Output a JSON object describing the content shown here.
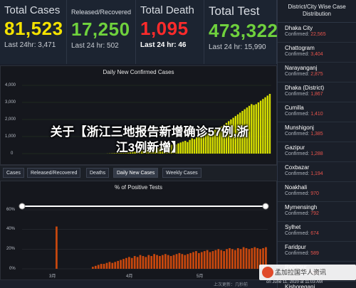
{
  "stats": [
    {
      "title": "Total Cases",
      "value": "81,523",
      "sub_label": "Last 24hr: ",
      "sub_value": "3,471",
      "color": "#f4e200"
    },
    {
      "title": "Released/Recovered",
      "value": "17,250",
      "sub_label": "Last 24 hr: ",
      "sub_value": "502",
      "color": "#6fd13d"
    },
    {
      "title": "Total Death",
      "value": "1,095",
      "sub_label": "Last 24 hr: ",
      "sub_value": "46",
      "color": "#ff2b2b"
    },
    {
      "title": "Total Test",
      "value": "473,322",
      "sub_label": "Last 24 hr: ",
      "sub_value": "15,990",
      "color": "#6fd13d"
    }
  ],
  "chart1": {
    "title": "Daily New Confirmed Cases",
    "yticks": [
      "4,000",
      "3,000",
      "2,000",
      "1,000",
      "0"
    ]
  },
  "chart2": {
    "title": "% of Positive Tests",
    "yticks": [
      "60%",
      "40%",
      "20%",
      "0%"
    ],
    "xlabels": [
      "3月",
      "4月",
      "5月",
      "6月"
    ]
  },
  "tabs": [
    "Cases",
    "Released/Recovered",
    "Deaths",
    "Daily New Cases",
    "Weekly Cases"
  ],
  "sidebar": {
    "title": "District/City Wise Case Distribution",
    "confirmed_label": "Confirmed: ",
    "items": [
      {
        "name": "Dhaka City",
        "value": "22,565"
      },
      {
        "name": "Chattogram",
        "value": "3,404"
      },
      {
        "name": "Narayanganj",
        "value": "2,875"
      },
      {
        "name": "Dhaka (District)",
        "value": "1,867"
      },
      {
        "name": "Cumilla",
        "value": "1,410"
      },
      {
        "name": "Munshigonj",
        "value": "1,385"
      },
      {
        "name": "Gazipur",
        "value": "1,288"
      },
      {
        "name": "Coxbazar",
        "value": "1,194"
      },
      {
        "name": "Noakhali",
        "value": "970"
      },
      {
        "name": "Mymensingh",
        "value": "792"
      },
      {
        "name": "Sylhet",
        "value": "674"
      },
      {
        "name": "Faridpur",
        "value": "589"
      },
      {
        "name": "Rangpur",
        "value": "589"
      },
      {
        "name": "Kishoreganj",
        "value": ""
      }
    ]
  },
  "overlay": {
    "line1": "关于【浙江三地报告新增确诊57例,浙",
    "line2": "江3例新增】"
  },
  "brand": "孟加拉国华人资讯",
  "update_text": "on June 11, 2020 at 11:03 AM",
  "footer_src": "上次更新：几秒前",
  "chart_data": [
    {
      "type": "bar",
      "title": "Daily New Confirmed Cases",
      "ylim": [
        0,
        4000
      ],
      "values": [
        0,
        0,
        0,
        0,
        0,
        0,
        0,
        0,
        0,
        0,
        0,
        0,
        0,
        0,
        0,
        0,
        0,
        0,
        0,
        0,
        0,
        0,
        0,
        0,
        0,
        0,
        0,
        0,
        0,
        0,
        0,
        0,
        0,
        0,
        0,
        0,
        0,
        5,
        10,
        15,
        20,
        25,
        35,
        40,
        45,
        50,
        60,
        80,
        110,
        120,
        140,
        160,
        180,
        200,
        230,
        280,
        300,
        310,
        320,
        330,
        380,
        420,
        450,
        480,
        500,
        520,
        560,
        540,
        600,
        650,
        700,
        750,
        680,
        800,
        900,
        850,
        950,
        1000,
        1100,
        1050,
        1150,
        1200,
        1300,
        1250,
        1400,
        1500,
        1550,
        1600,
        1700,
        1800,
        1900,
        2000,
        2100,
        2200,
        2300,
        2400,
        2500,
        2600,
        2700,
        2800,
        2900,
        2850,
        2900,
        3000,
        3100,
        3200,
        3300,
        3400,
        3500
      ]
    },
    {
      "type": "bar",
      "title": "% of Positive Tests",
      "ylim": [
        0,
        60
      ],
      "x_labels": [
        "3月",
        "4月",
        "5月",
        "6月"
      ],
      "values": [
        0,
        0,
        0,
        0,
        0,
        0,
        0,
        0,
        0,
        0,
        0,
        0,
        43,
        0,
        0,
        0,
        0,
        0,
        0,
        0,
        0,
        0,
        0,
        0,
        0,
        2,
        3,
        4,
        5,
        5,
        6,
        7,
        6,
        7,
        8,
        9,
        10,
        11,
        12,
        11,
        13,
        12,
        14,
        13,
        12,
        14,
        13,
        15,
        14,
        13,
        14,
        15,
        14,
        13,
        14,
        15,
        16,
        15,
        14,
        15,
        16,
        17,
        18,
        16,
        17,
        18,
        19,
        17,
        18,
        19,
        20,
        19,
        18,
        20,
        21,
        20,
        19,
        21,
        20,
        22,
        21,
        20,
        21,
        22,
        21,
        20,
        21,
        22
      ]
    }
  ]
}
